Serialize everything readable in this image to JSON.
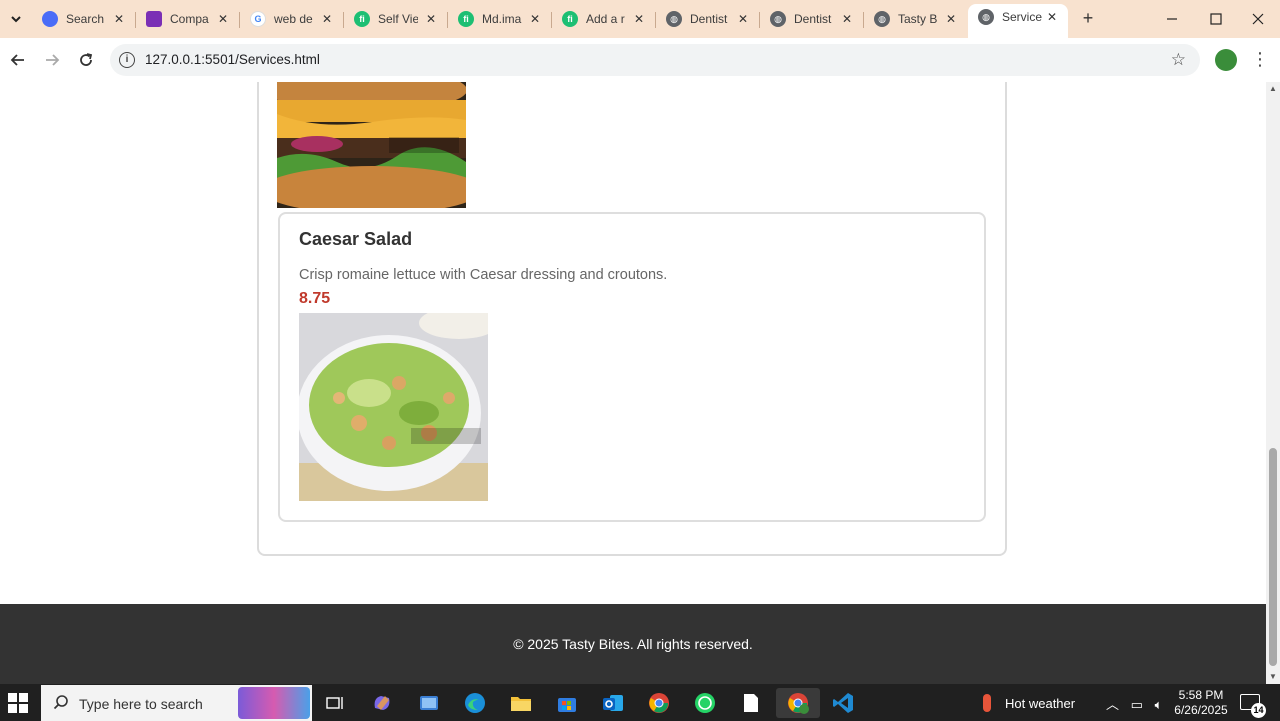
{
  "browser": {
    "tabs": [
      {
        "title": "Search",
        "favicon": "copilot-icon",
        "color": "#4a6cf7"
      },
      {
        "title": "Compa",
        "favicon": "calendar-icon",
        "color": "#7b2fb5"
      },
      {
        "title": "web de",
        "favicon": "google-icon",
        "color": "#ffffff"
      },
      {
        "title": "Self Vie",
        "favicon": "fiverr-icon",
        "color": "#1dbf73"
      },
      {
        "title": "Md.ima",
        "favicon": "fiverr-icon",
        "color": "#1dbf73"
      },
      {
        "title": "Add a r",
        "favicon": "fiverr-icon",
        "color": "#1dbf73"
      },
      {
        "title": "Dentist",
        "favicon": "globe-icon",
        "color": "#5f6368"
      },
      {
        "title": "Dentist",
        "favicon": "globe-icon",
        "color": "#5f6368"
      },
      {
        "title": "Tasty Bi",
        "favicon": "globe-icon",
        "color": "#5f6368"
      },
      {
        "title": "Service",
        "favicon": "globe-icon",
        "color": "#5f6368"
      }
    ],
    "active_tab_index": 9,
    "url": "127.0.0.1:5501/Services.html"
  },
  "page": {
    "menu_item": {
      "title": "Caesar Salad",
      "description": "Crisp romaine lettuce with Caesar dressing and croutons.",
      "price": "8.75"
    },
    "footer_text": "© 2025 Tasty Bites. All rights reserved.",
    "price_color": "#c0392b"
  },
  "taskbar": {
    "search_placeholder": "Type here to search",
    "weather": "Hot weather",
    "time": "5:58 PM",
    "date": "6/26/2025",
    "notification_count": "14"
  }
}
